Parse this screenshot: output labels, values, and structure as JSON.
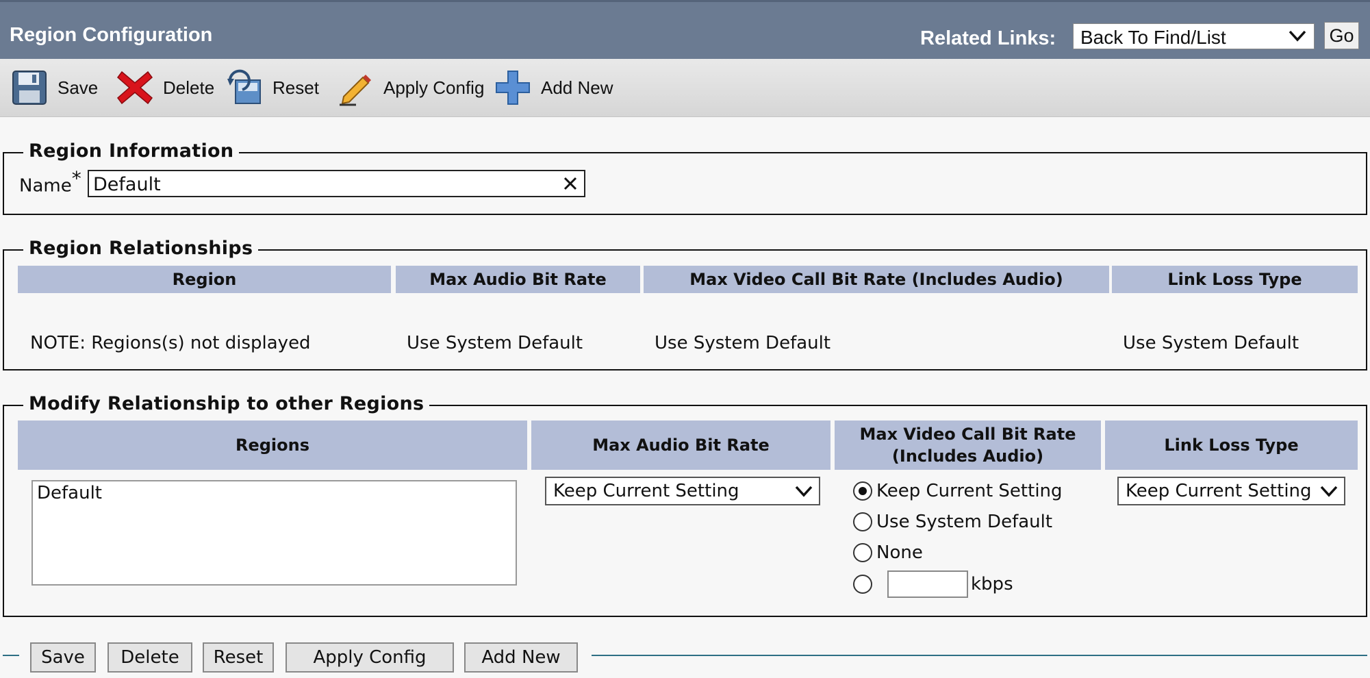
{
  "header": {
    "title": "Region Configuration",
    "related_links_label": "Related Links:",
    "related_links_value": "Back To Find/List",
    "go_label": "Go"
  },
  "toolbar": {
    "save": "Save",
    "delete": "Delete",
    "reset": "Reset",
    "apply_config": "Apply Config",
    "add_new": "Add New"
  },
  "region_info": {
    "legend": "Region Information",
    "name_label": "Name",
    "required_mark": "*",
    "name_value": "Default"
  },
  "region_relationships": {
    "legend": "Region Relationships",
    "columns": [
      "Region",
      "Max Audio Bit Rate",
      "Max Video Call Bit Rate (Includes Audio)",
      "Link Loss Type"
    ],
    "row": [
      "NOTE: Regions(s) not displayed",
      "Use System Default",
      "Use System Default",
      "Use System Default"
    ]
  },
  "modify": {
    "legend": "Modify Relationship to other Regions",
    "columns": [
      "Regions",
      "Max Audio Bit Rate",
      "Max Video Call Bit Rate (Includes Audio)",
      "Link Loss Type"
    ],
    "regions_list": [
      "Default"
    ],
    "audio_select": "Keep Current Setting",
    "video_options": [
      "Keep Current Setting",
      "Use System Default",
      "None"
    ],
    "video_selected_index": 0,
    "kbps_value": "",
    "kbps_unit": "kbps",
    "link_loss_select": "Keep Current Setting"
  },
  "bottom_buttons": {
    "save": "Save",
    "delete": "Delete",
    "reset": "Reset",
    "apply_config": "Apply Config",
    "add_new": "Add New"
  },
  "colors": {
    "header_bg": "#6b7b92",
    "table_header_bg": "#b3bdd7",
    "delete_red": "#d8141c",
    "add_blue": "#5a8fd4",
    "rule_teal": "#2e6f84"
  }
}
